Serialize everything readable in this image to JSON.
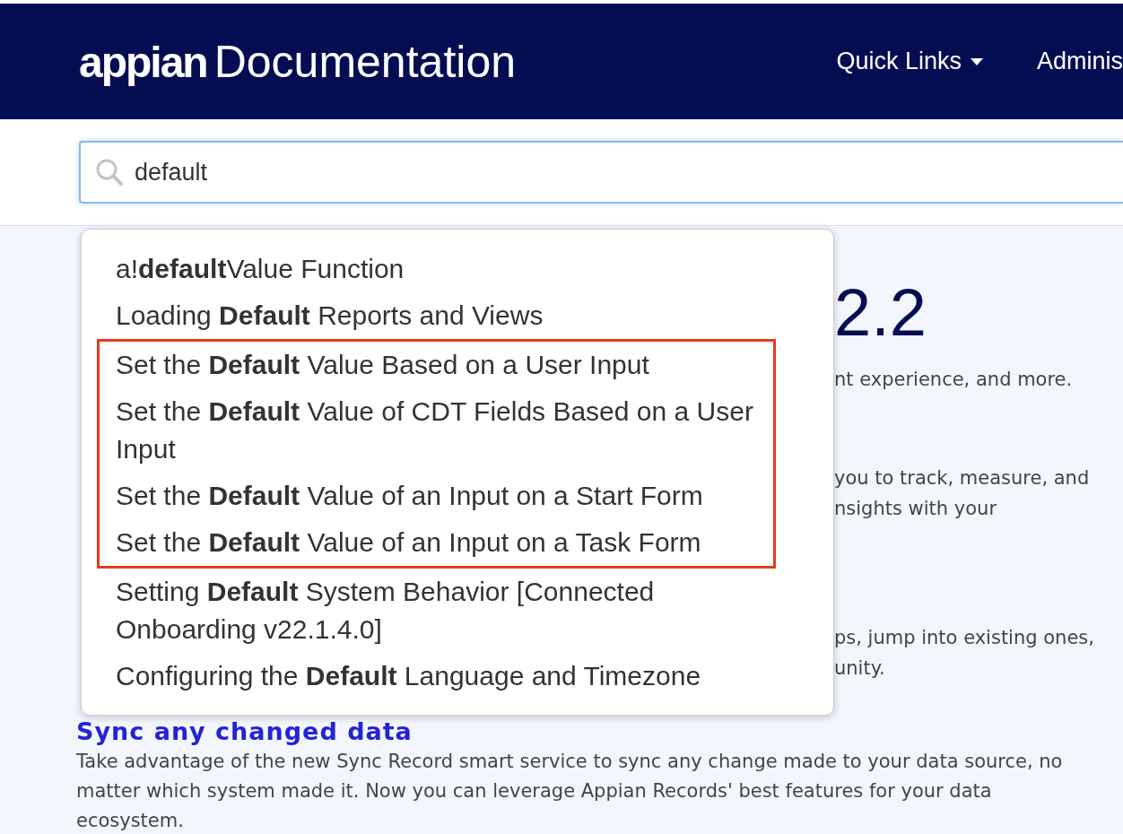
{
  "header": {
    "logo_wordmark": "appian",
    "logo_text": "Documentation",
    "nav": [
      {
        "label": "Quick Links",
        "dropdown": true
      },
      {
        "label": "Adminis",
        "dropdown": false
      }
    ]
  },
  "search": {
    "value": "default"
  },
  "suggestions": [
    {
      "text": "a!**default**Value Function",
      "highlighted": false
    },
    {
      "text": "Loading **Default** Reports and Views",
      "highlighted": false
    },
    {
      "text": "Set the **Default** Value Based on a User Input",
      "highlighted": true
    },
    {
      "text": "Set the **Default** Value of CDT Fields Based on a User Input",
      "highlighted": true
    },
    {
      "text": "Set the **Default** Value of an Input on a Start Form",
      "highlighted": true
    },
    {
      "text": "Set the **Default** Value of an Input on a Task Form",
      "highlighted": true
    },
    {
      "text": "Setting **Default** System Behavior [Connected Onboarding v22.1.4.0]",
      "highlighted": false
    },
    {
      "text": "Configuring the **Default** Language and Timezone",
      "highlighted": false
    }
  ],
  "background": {
    "heading_fragment": "2.2",
    "fragments": [
      [
        "nt experience, and more."
      ],
      [
        "you to track, measure, and",
        "nsights with your"
      ],
      [
        "ps, jump into existing ones,",
        "unity."
      ]
    ],
    "section": {
      "title": "Sync any changed data",
      "body": "Take advantage of the new Sync Record smart service to sync any change made to your data source, no matter which system made it. Now you can leverage Appian Records' best features for your data ecosystem."
    }
  }
}
